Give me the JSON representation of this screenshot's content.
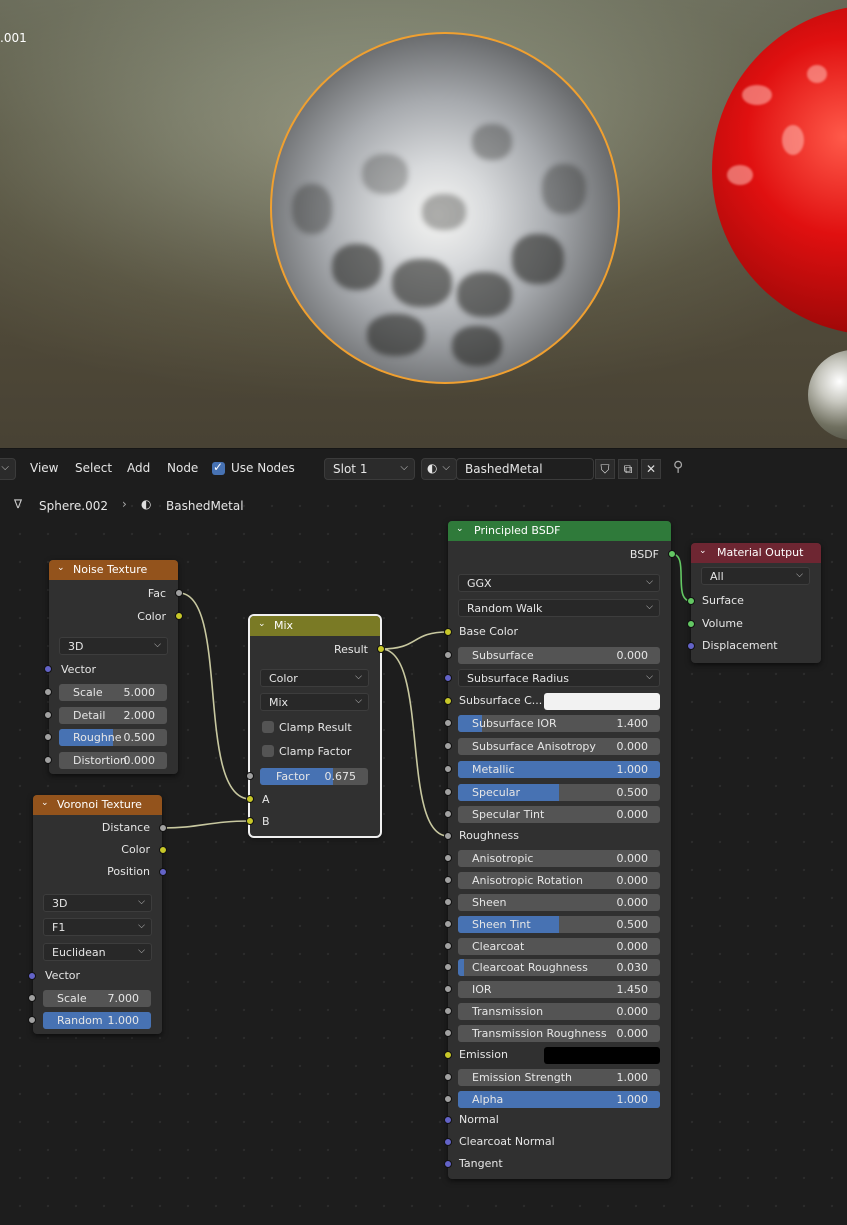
{
  "viewport": {
    "label": ".001"
  },
  "header": {
    "editor_type_icon": "node-editor-icon",
    "menus": [
      "View",
      "Select",
      "Add",
      "Node"
    ],
    "use_nodes_label": "Use Nodes",
    "use_nodes_checked": true,
    "slot_label": "Slot 1",
    "material_name": "BashedMetal"
  },
  "breadcrumb": {
    "object_name": "Sphere.002",
    "material_name": "BashedMetal"
  },
  "colors": {
    "accent": "#4772b3",
    "selection": "#f0a030",
    "texture_header": "#93531c",
    "shader_header": "#2f7a3a",
    "converter_header": "#7a7a25",
    "output_header": "#6e2632"
  },
  "nodes": {
    "noise": {
      "title": "Noise Texture",
      "out_fac": "Fac",
      "out_color": "Color",
      "dimension": "3D",
      "in_vector": "Vector",
      "scale_label": "Scale",
      "scale_value": "5.000",
      "detail_label": "Detail",
      "detail_value": "2.000",
      "roughness_label": "Roughne",
      "roughness_value": "0.500",
      "roughness_fraction": 0.5,
      "distortion_label": "Distortion",
      "distortion_value": "0.000"
    },
    "voronoi": {
      "title": "Voronoi Texture",
      "out_distance": "Distance",
      "out_color": "Color",
      "out_position": "Position",
      "dimension": "3D",
      "feature": "F1",
      "metric": "Euclidean",
      "in_vector": "Vector",
      "scale_label": "Scale",
      "scale_value": "7.000",
      "random_label": "Random",
      "random_value": "1.000",
      "random_fraction": 1.0
    },
    "mix": {
      "title": "Mix",
      "out_result": "Result",
      "data_type": "Color",
      "blend": "Mix",
      "clamp_result": "Clamp Result",
      "clamp_factor": "Clamp Factor",
      "factor_label": "Factor",
      "factor_value": "0.675",
      "factor_fraction": 0.675,
      "in_a": "A",
      "in_b": "B"
    },
    "bsdf": {
      "title": "Principled BSDF",
      "out_bsdf": "BSDF",
      "distribution": "GGX",
      "subsurface_method": "Random Walk",
      "base_color": "Base Color",
      "subsurface_radius": "Subsurface Radius",
      "subsurface_color": "Subsurface C...",
      "fields": [
        {
          "label": "Subsurface",
          "value": "0.000",
          "fraction": 0
        },
        {
          "label": "Subsurface IOR",
          "value": "1.400",
          "fraction": 0.12
        },
        {
          "label": "Subsurface Anisotropy",
          "value": "0.000",
          "fraction": 0
        },
        {
          "label": "Metallic",
          "value": "1.000",
          "fraction": 1
        },
        {
          "label": "Specular",
          "value": "0.500",
          "fraction": 0.5
        },
        {
          "label": "Specular Tint",
          "value": "0.000",
          "fraction": 0
        },
        {
          "label": "Anisotropic",
          "value": "0.000",
          "fraction": 0
        },
        {
          "label": "Anisotropic Rotation",
          "value": "0.000",
          "fraction": 0
        },
        {
          "label": "Sheen",
          "value": "0.000",
          "fraction": 0
        },
        {
          "label": "Sheen Tint",
          "value": "0.500",
          "fraction": 0.5
        },
        {
          "label": "Clearcoat",
          "value": "0.000",
          "fraction": 0
        },
        {
          "label": "Clearcoat Roughness",
          "value": "0.030",
          "fraction": 0.03
        },
        {
          "label": "IOR",
          "value": "1.450",
          "fraction": 0
        },
        {
          "label": "Transmission",
          "value": "0.000",
          "fraction": 0
        },
        {
          "label": "Transmission Roughness",
          "value": "0.000",
          "fraction": 0
        },
        {
          "label": "Emission Strength",
          "value": "1.000",
          "fraction": 0
        },
        {
          "label": "Alpha",
          "value": "1.000",
          "fraction": 1
        }
      ],
      "roughness": "Roughness",
      "emission": "Emission",
      "normal": "Normal",
      "clearcoat_normal": "Clearcoat Normal",
      "tangent": "Tangent",
      "subsurface_color_swatch": "#f2f2f2",
      "emission_swatch": "#000000"
    },
    "output": {
      "title": "Material Output",
      "target": "All",
      "surface": "Surface",
      "volume": "Volume",
      "displacement": "Displacement"
    }
  }
}
